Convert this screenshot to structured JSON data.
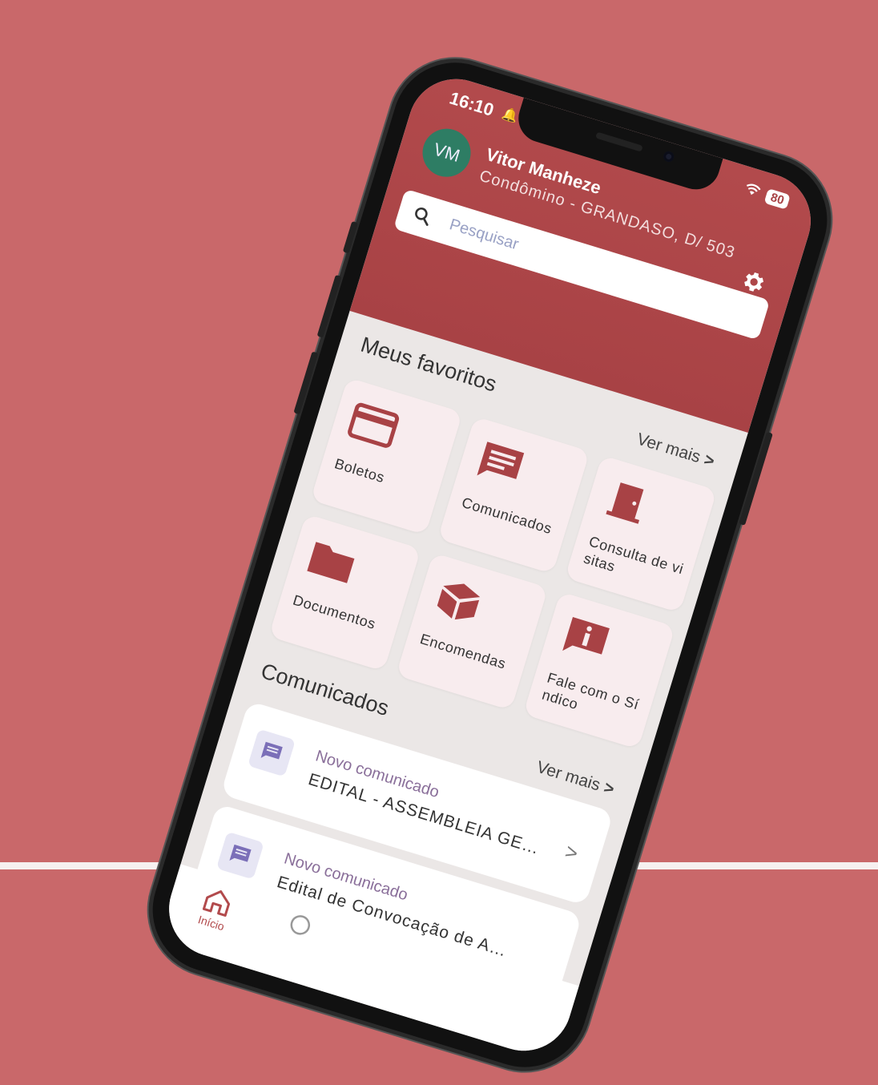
{
  "status": {
    "time": "16:10",
    "battery": "80"
  },
  "user": {
    "initials": "VM",
    "name": "Vitor Manheze",
    "role": "Condômino - GRANDASO, D/ 503"
  },
  "search": {
    "placeholder": "Pesquisar"
  },
  "favorites": {
    "title": "Meus favoritos",
    "see_more": "Ver mais",
    "items": [
      {
        "label": "Boletos",
        "icon": "credit-card-icon"
      },
      {
        "label": "Comunicados",
        "icon": "message-icon"
      },
      {
        "label": "Consulta de visitas",
        "icon": "door-icon"
      },
      {
        "label": "Documentos",
        "icon": "folder-icon"
      },
      {
        "label": "Encomendas",
        "icon": "package-icon"
      },
      {
        "label": "Fale com o Síndico",
        "icon": "info-icon"
      }
    ]
  },
  "communications": {
    "title": "Comunicados",
    "see_more": "Ver mais",
    "items": [
      {
        "type": "Novo comunicado",
        "subject": "EDITAL - ASSEMBLEIA GERAL ..."
      },
      {
        "type": "Novo comunicado",
        "subject": "Edital de Convocação de As..."
      }
    ]
  },
  "tabbar": {
    "home_label": "Início"
  },
  "colors": {
    "brand": "#a84245",
    "background": "#c9686a",
    "avatar": "#2e7d64"
  }
}
